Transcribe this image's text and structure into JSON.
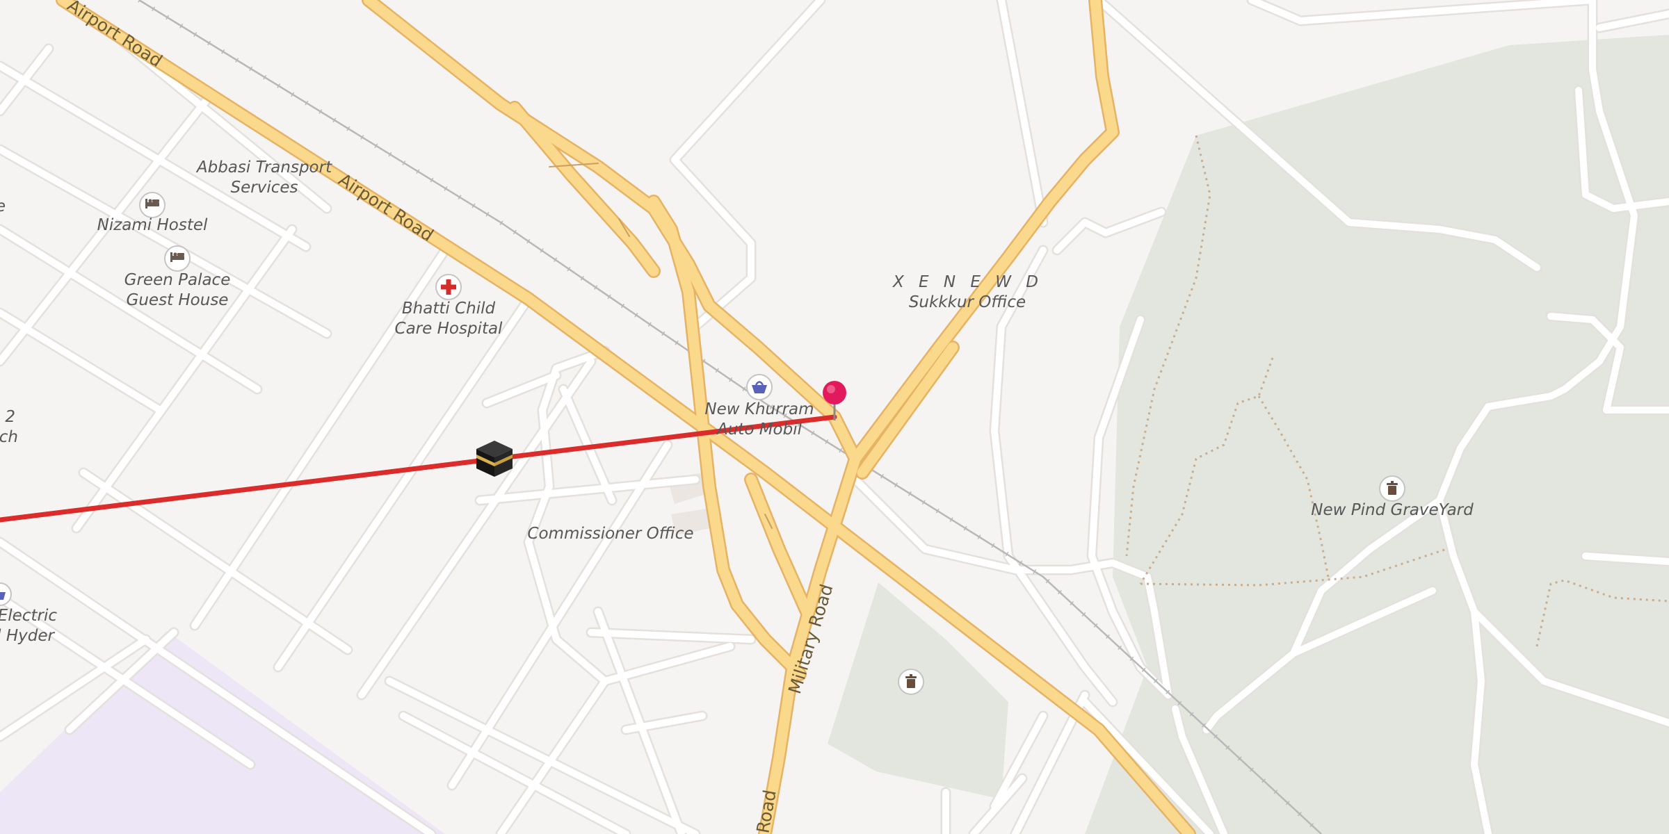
{
  "map": {
    "colors": {
      "background": "#f6f4f2",
      "minor_road": "#ffffff",
      "minor_road_casing": "#e4e0dc",
      "major_road": "#fbd98c",
      "major_road_casing": "#e6b264",
      "green_area": "#e3e6df",
      "purple_area": "#ece6f6",
      "railway": "#b8b8b8",
      "route_line": "#dc2b2b",
      "pin": "#e2195c",
      "poi_icon_border": "#c4c4c4",
      "hospital_icon": "#d52b2b",
      "shop_icon": "#5a61b8",
      "label_text": "#575757",
      "road_label_text": "#6b5a36"
    },
    "road_labels": {
      "airport_road_top": "Airport Road",
      "airport_road": "Airport Road",
      "military_road": "Military Road",
      "road_bottom": "Road"
    },
    "place_labels": {
      "abbasi_l1": "Abbasi Transport",
      "abbasi_l2": "Services",
      "nizami": "Nizami Hostel",
      "green_palace_l1": "Green Palace",
      "green_palace_l2": "Guest House",
      "bhatti_l1": "Bhatti Child",
      "bhatti_l2": "Care Hospital",
      "new_khurram_l1": "New Khurram",
      "new_khurram_l2": "Auto Mobil",
      "xenewd_l1": "X E N E W D",
      "xenewd_l2": "Sukkkur Office",
      "commissioner": "Commissioner Office",
      "graveyard": "New Pind GraveYard",
      "electric_l1": "e Electric",
      "electric_l2": "al Hyder",
      "branch_l1": "2",
      "branch_l2": "nch",
      "edge_fragment": "e"
    },
    "pois": [
      {
        "name": "Nizami Hostel",
        "icon": "bed-icon"
      },
      {
        "name": "Green Palace Guest House",
        "icon": "bed-icon"
      },
      {
        "name": "Bhatti Child Care Hospital",
        "icon": "hospital-cross-icon"
      },
      {
        "name": "New Khurram Auto Mobil",
        "icon": "shopping-basket-icon"
      },
      {
        "name": "New Pind GraveYard",
        "icon": "graveyard-icon"
      },
      {
        "name": "Graveyard (unlabeled)",
        "icon": "graveyard-icon"
      }
    ],
    "markers": [
      {
        "name": "Selected location",
        "icon": "location-pin-icon"
      },
      {
        "name": "Kaaba (Qibla direction)",
        "icon": "kaaba-icon"
      }
    ],
    "overlays": [
      {
        "name": "Qibla direction line",
        "color": "#dc2b2b"
      }
    ]
  }
}
